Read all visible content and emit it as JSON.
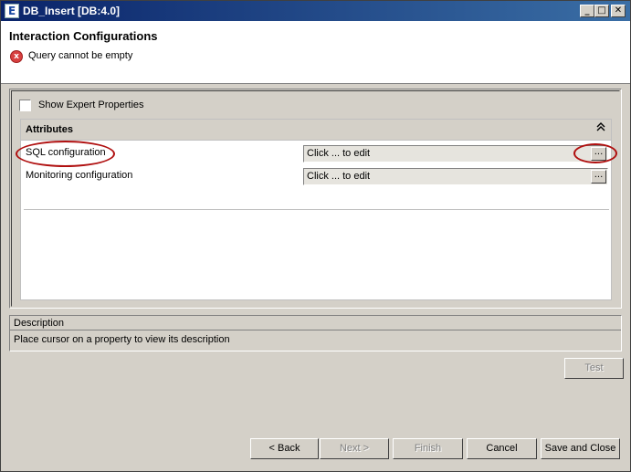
{
  "window": {
    "title": "DB_Insert [DB:4.0]",
    "min_glyph": "_",
    "max_glyph": "□",
    "close_glyph": "✕"
  },
  "header": {
    "heading": "Interaction Configurations",
    "error_message": "Query cannot be empty",
    "error_glyph": "x"
  },
  "main": {
    "show_expert_label": "Show Expert Properties",
    "show_expert_checked": false,
    "attributes": {
      "title": "Attributes",
      "collapse_glyph": "⌃",
      "properties": [
        {
          "label": "SQL configuration",
          "value": "Click ... to edit",
          "button": "..."
        },
        {
          "label": "Monitoring configuration",
          "value": "Click ... to edit",
          "button": "..."
        }
      ]
    }
  },
  "description": {
    "title": "Description",
    "text": "Place cursor on a property to view its description"
  },
  "buttons": {
    "test": "Test",
    "back": "< Back",
    "next": "Next >",
    "finish": "Finish",
    "cancel": "Cancel",
    "save_close": "Save and Close"
  },
  "colors": {
    "annotation_oval": "#b01010",
    "error_icon": "#d84040"
  }
}
